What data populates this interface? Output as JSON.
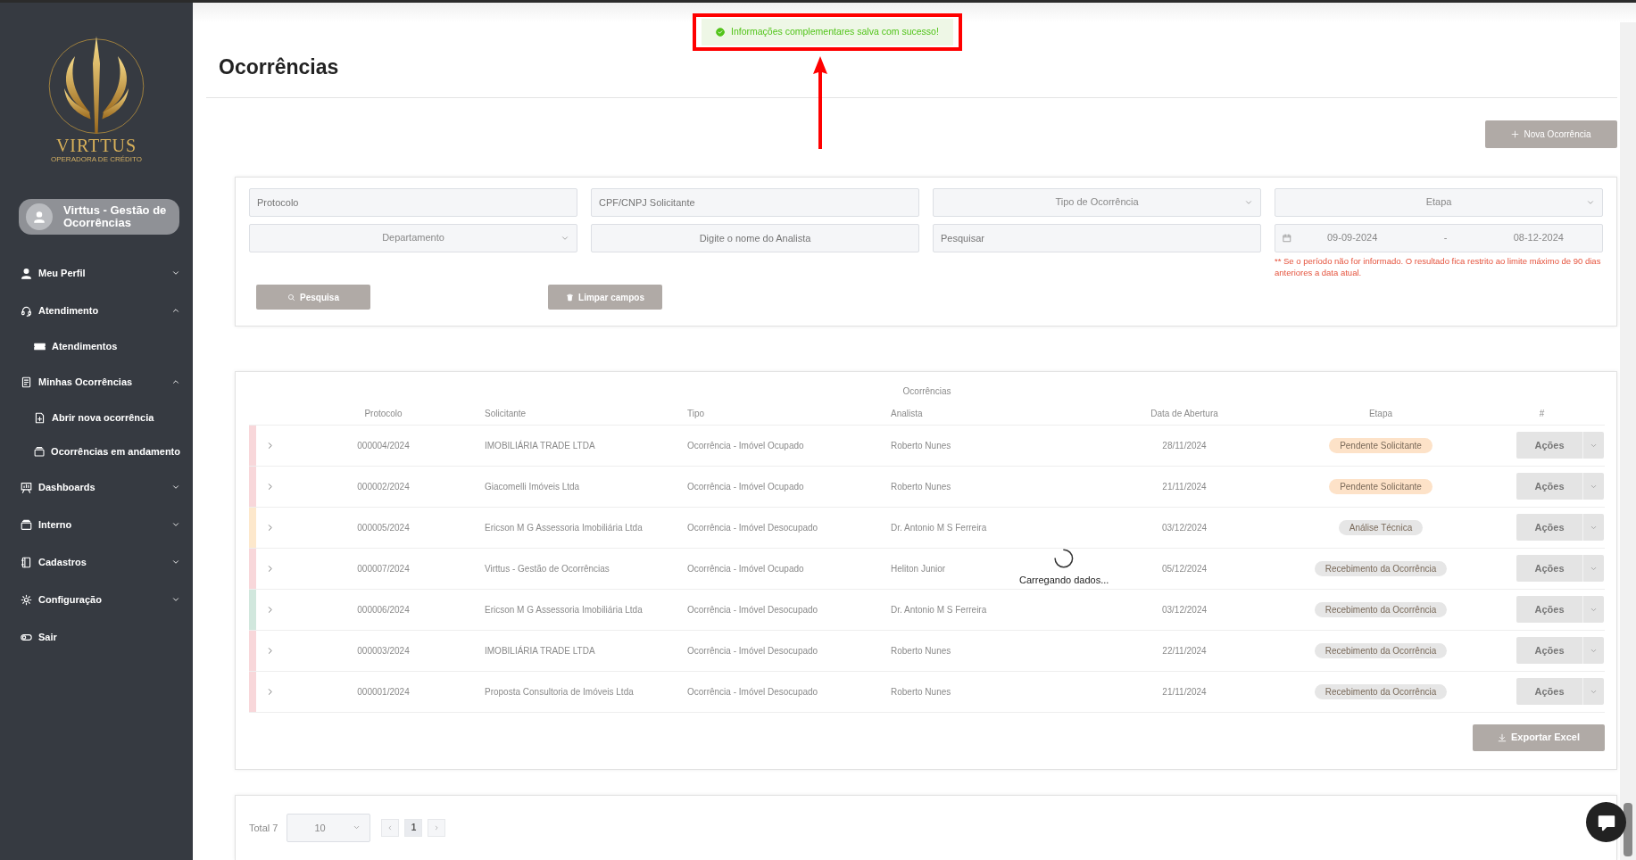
{
  "logo": {
    "name": "VIRTTUS",
    "tagline": "OPERADORA DE CRÉDITO"
  },
  "user": {
    "name": "Virttus - Gestão de Ocorrências"
  },
  "menu": [
    {
      "label": "Meu Perfil",
      "kind": "person",
      "expanded": false
    },
    {
      "label": "Atendimento",
      "kind": "headset",
      "expanded": true,
      "children": [
        {
          "label": "Atendimentos",
          "kind": "ticket"
        }
      ]
    },
    {
      "label": "Minhas Ocorrências",
      "kind": "document",
      "expanded": true,
      "children": [
        {
          "label": "Abrir nova ocorrência",
          "kind": "file-plus"
        },
        {
          "label": "Ocorrências em andamento",
          "kind": "tray"
        }
      ]
    },
    {
      "label": "Dashboards",
      "kind": "board",
      "expanded": false
    },
    {
      "label": "Interno",
      "kind": "tray",
      "expanded": false
    },
    {
      "label": "Cadastros",
      "kind": "book",
      "expanded": false
    },
    {
      "label": "Configuração",
      "kind": "gear",
      "expanded": false
    },
    {
      "label": "Sair",
      "kind": "toggle"
    }
  ],
  "toast": {
    "kind": "success",
    "text": "Informações complementares salva com sucesso!"
  },
  "page_title": "Ocorrências",
  "new_button": "Nova Ocorrência",
  "filters": [
    {
      "kind": "text",
      "placeholder": "Protocolo"
    },
    {
      "kind": "text",
      "placeholder": "CPF/CNPJ Solicitante"
    },
    {
      "kind": "select",
      "placeholder": "Tipo de Ocorrência"
    },
    {
      "kind": "select",
      "placeholder": "Etapa"
    },
    {
      "kind": "select",
      "placeholder": "Departamento"
    },
    {
      "kind": "center",
      "placeholder": "Digite o nome do Analista"
    },
    {
      "kind": "text",
      "placeholder": "Pesquisar"
    },
    {
      "kind": "daterange",
      "start": "09-09-2024",
      "separator": "-",
      "end": "08-12-2024",
      "note": "** Se o período não for informado. O resultado fica restrito ao limite máximo de 90 dias anteriores a data atual."
    }
  ],
  "filter_buttons": [
    {
      "label": "Pesquisa",
      "kind": "search"
    },
    {
      "label": "Limpar campos",
      "kind": "trash"
    }
  ],
  "table": {
    "caption": "Ocorrências",
    "columns": [
      "Protocolo",
      "Solicitante",
      "Tipo",
      "Analista",
      "Data de Abertura",
      "Etapa",
      "#"
    ],
    "rows": [
      {
        "color": "#f8d7da",
        "protocol": "000004/2024",
        "requester": "IMOBILIÁRIA TRADE LTDA",
        "type": "Ocorrência - Imóvel Ocupado",
        "analyst": "Roberto Nunes",
        "date": "28/11/2024",
        "stage": {
          "label": "Pendente Solicitante",
          "color": "#fde2c8"
        },
        "action": "Ações"
      },
      {
        "color": "#f8d7da",
        "protocol": "000002/2024",
        "requester": "Giacomelli Imóveis Ltda",
        "type": "Ocorrência - Imóvel Ocupado",
        "analyst": "Roberto Nunes",
        "date": "21/11/2024",
        "stage": {
          "label": "Pendente Solicitante",
          "color": "#fde2c8"
        },
        "action": "Ações"
      },
      {
        "color": "#fde8cc",
        "protocol": "000005/2024",
        "requester": "Ericson M G Assessoria Imobiliária Ltda",
        "type": "Ocorrência - Imóvel Desocupado",
        "analyst": "Dr. Antonio M S Ferreira",
        "date": "03/12/2024",
        "stage": {
          "label": "Análise Técnica",
          "color": "#e6e6e6"
        },
        "action": "Ações"
      },
      {
        "color": "#f8d7da",
        "protocol": "000007/2024",
        "requester": "Virttus - Gestão de Ocorrências",
        "type": "Ocorrência - Imóvel Ocupado",
        "analyst": "Heliton Junior",
        "date": "05/12/2024",
        "stage": {
          "label": "Recebimento da Ocorrência",
          "color": "#e6e6e6"
        },
        "action": "Ações"
      },
      {
        "color": "#d1e7dd",
        "protocol": "000006/2024",
        "requester": "Ericson M G Assessoria Imobiliária Ltda",
        "type": "Ocorrência - Imóvel Desocupado",
        "analyst": "Dr. Antonio M S Ferreira",
        "date": "03/12/2024",
        "stage": {
          "label": "Recebimento da Ocorrência",
          "color": "#e6e6e6"
        },
        "action": "Ações"
      },
      {
        "color": "#f8d7da",
        "protocol": "000003/2024",
        "requester": "IMOBILIÁRIA TRADE LTDA",
        "type": "Ocorrência - Imóvel Desocupado",
        "analyst": "Roberto Nunes",
        "date": "22/11/2024",
        "stage": {
          "label": "Recebimento da Ocorrência",
          "color": "#e6e6e6"
        },
        "action": "Ações"
      },
      {
        "color": "#f8d7da",
        "protocol": "000001/2024",
        "requester": "Proposta Consultoria de Imóveis Ltda",
        "type": "Ocorrência - Imóvel Desocupado",
        "analyst": "Roberto Nunes",
        "date": "21/11/2024",
        "stage": {
          "label": "Recebimento da Ocorrência",
          "color": "#e6e6e6"
        },
        "action": "Ações"
      }
    ],
    "loading": "Carregando dados...",
    "export": "Exportar Excel"
  },
  "pagination": {
    "total": "Total 7",
    "page_size": "10",
    "pages": [
      {
        "label": "1",
        "selected": true
      }
    ]
  }
}
